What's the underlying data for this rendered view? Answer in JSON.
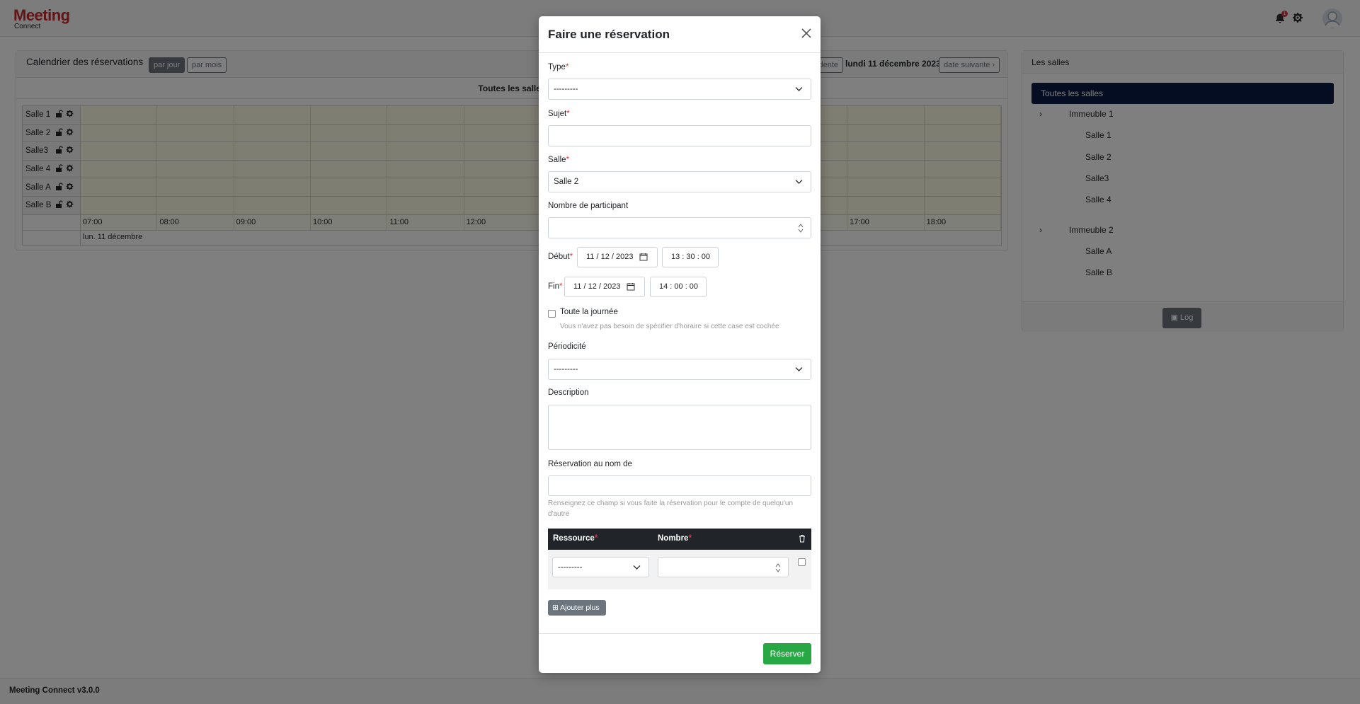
{
  "brand": {
    "name": "Meeting",
    "sub": "Connect",
    "accent": "#c62828"
  },
  "navbar": {
    "notification_count": "1",
    "icons": [
      "bell-icon",
      "gear-icon",
      "avatar"
    ]
  },
  "calendar": {
    "title": "Calendrier des réservations",
    "view_day": "par jour",
    "view_month": "par mois",
    "prev_partial": "dente",
    "current_date": "lundi 11 décembre 2023",
    "next_label": "date suivante",
    "subheader": "Toutes les salles",
    "rooms": [
      "Salle 1",
      "Salle 2",
      "Salle3",
      "Salle 4",
      "Salle A",
      "Salle B"
    ],
    "hours": [
      "07:00",
      "08:00",
      "09:00",
      "10:00",
      "11:00",
      "12:00",
      "",
      "",
      "",
      "",
      "17:00",
      "18:00"
    ],
    "day_label": "lun. 11 décembre"
  },
  "rooms_panel": {
    "title": "Les salles",
    "all": "Toutes les salles",
    "buildings": [
      {
        "name": "Immeuble 1",
        "rooms": [
          "Salle 1",
          "Salle 2",
          "Salle3",
          "Salle 4"
        ]
      },
      {
        "name": "Immeuble 2",
        "rooms": [
          "Salle A",
          "Salle B"
        ]
      }
    ],
    "log_button": "Log"
  },
  "footer": {
    "text": "Meeting Connect v3.0.0"
  },
  "modal": {
    "title": "Faire une réservation",
    "type_label": "Type",
    "type_value": "---------",
    "subject_label": "Sujet",
    "subject_value": "",
    "room_label": "Salle",
    "room_value": "Salle 2",
    "participants_label": "Nombre de participant",
    "participants_value": "",
    "start_label": "Début",
    "start_date": "11 / 12 / 2023",
    "start_time": "13 : 30 : 00",
    "end_label": "Fin",
    "end_date": "11 / 12 / 2023",
    "end_time": "14 : 00 : 00",
    "allday_label": "Toute la journée",
    "allday_help": "Vous n'avez pas besoin de spécifier d'horaire si cette case est cochée",
    "periodicity_label": "Périodicité",
    "periodicity_value": "---------",
    "description_label": "Description",
    "onbehalf_label": "Réservation au nom de",
    "onbehalf_help": "Renseignez ce champ si vous faite la réservation pour le compte de quelqu'un d'autre",
    "resource_header": "Ressource",
    "count_header": "Nombre",
    "resource_value": "---------",
    "add_more": "Ajouter plus",
    "submit": "Réserver",
    "required_mark": "*"
  }
}
